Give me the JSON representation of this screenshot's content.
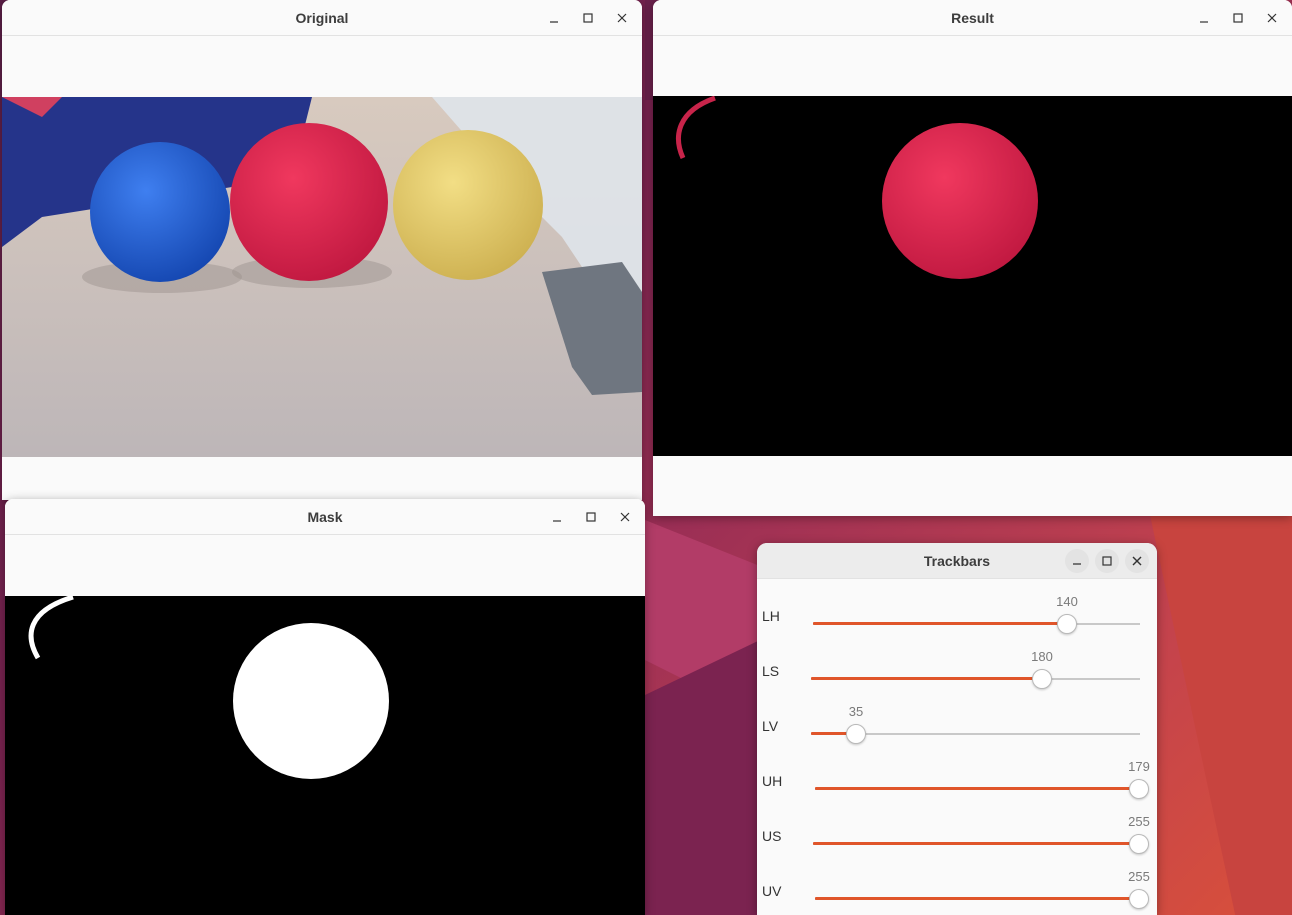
{
  "windows": {
    "original": {
      "title": "Original"
    },
    "result": {
      "title": "Result"
    },
    "mask": {
      "title": "Mask"
    },
    "trackbars": {
      "title": "Trackbars"
    }
  },
  "window_controls": {
    "minimize": "minimize-icon",
    "maximize": "maximize-icon",
    "close": "close-icon"
  },
  "trackbars": [
    {
      "label": "LH",
      "value": "140",
      "max": 179
    },
    {
      "label": "LS",
      "value": "180",
      "max": 255
    },
    {
      "label": "LV",
      "value": "35",
      "max": 255
    },
    {
      "label": "UH",
      "value": "179",
      "max": 179
    },
    {
      "label": "US",
      "value": "255",
      "max": 255
    },
    {
      "label": "UV",
      "value": "255",
      "max": 255
    }
  ],
  "colors": {
    "accent": "#e0552a",
    "ball_red": "#e0234d",
    "ball_blue": "#1f5fd6",
    "ball_yellow": "#e6cf6a"
  }
}
